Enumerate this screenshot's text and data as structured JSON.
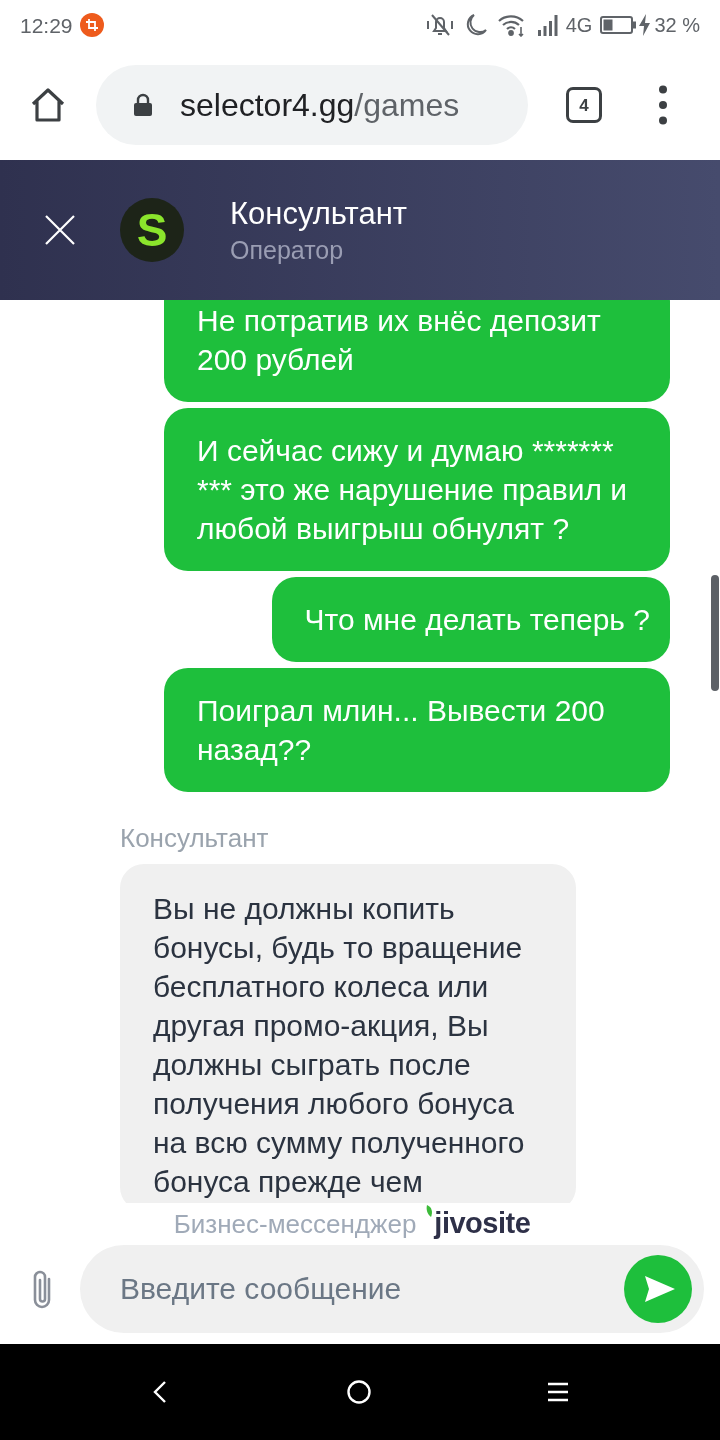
{
  "status_bar": {
    "time": "12:29",
    "network": "4G",
    "battery": "32 %"
  },
  "browser": {
    "url_host": "selector4.gg",
    "url_path": "/games",
    "tab_count": "4"
  },
  "chat_header": {
    "title": "Консультант",
    "subtitle": "Оператор",
    "avatar_letter": "S"
  },
  "messages": [
    {
      "kind": "outgoing",
      "text": "Не потратив их внёс депозит 200 рублей"
    },
    {
      "kind": "outgoing",
      "text": "И сейчас сижу и думаю ******* *** это же нарушение правил и любой выигрыш обнулят ?"
    },
    {
      "kind": "outgoing",
      "text": "Что мне делать теперь ?"
    },
    {
      "kind": "outgoing",
      "text": "Поиграл млин... Вывести 200 назад??"
    },
    {
      "kind": "incoming",
      "sender": "Консультант",
      "text": "Вы не должны копить бонусы, будь то вращение бесплатного колеса или другая промо-акция, Вы должны сыграть после получения любого бонуса на всю сумму полученного бонуса прежде чем"
    }
  ],
  "branding": {
    "label": "Бизнес-мессенджер",
    "logo": "jivosite"
  },
  "composer": {
    "placeholder": "Введите сообщение"
  }
}
